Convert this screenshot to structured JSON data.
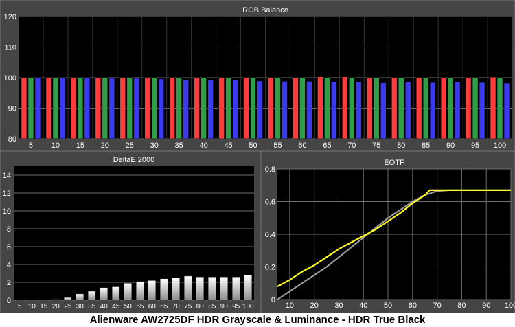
{
  "caption": "Alienware AW2725DF HDR Grayscale & Luminance - HDR True Black",
  "colors": {
    "panel_bg": "#454545",
    "plot_bg": "#000000",
    "grid": "#6e6e6e",
    "text": "#ffffff",
    "red": "#ff3b3b",
    "green": "#2f9e46",
    "blue": "#3a3af0",
    "eotf_target": "#9a9a9a",
    "eotf_measured": "#ffff22"
  },
  "chart_data": [
    {
      "id": "rgb",
      "type": "bar",
      "title": "RGB Balance",
      "xlabel": "",
      "ylabel": "",
      "ylim": [
        80,
        120
      ],
      "yticks": [
        80,
        90,
        100,
        110,
        120
      ],
      "categories": [
        "5",
        "10",
        "15",
        "20",
        "25",
        "30",
        "35",
        "40",
        "45",
        "50",
        "55",
        "60",
        "65",
        "70",
        "75",
        "80",
        "85",
        "90",
        "95",
        "100"
      ],
      "series": [
        {
          "color_key": "red",
          "values": [
            100,
            100,
            100,
            100,
            100,
            100,
            100,
            100,
            100,
            100,
            100,
            100,
            100.3,
            100.3,
            100,
            100,
            100,
            100,
            100,
            100.2
          ]
        },
        {
          "color_key": "green",
          "values": [
            100,
            100,
            100,
            100,
            100,
            100,
            100,
            100,
            100,
            100,
            100,
            100,
            100,
            100,
            100,
            100,
            100,
            100,
            100,
            100
          ]
        },
        {
          "color_key": "blue",
          "values": [
            100,
            100,
            100,
            99.8,
            99.8,
            99.6,
            99.4,
            99.2,
            99.2,
            98.9,
            98.8,
            98.8,
            98.6,
            98.5,
            98.3,
            98.5,
            98.4,
            98.5,
            98.4,
            98.2
          ]
        }
      ],
      "grid": true
    },
    {
      "id": "deltae",
      "type": "bar",
      "title": "DeltaE 2000",
      "xlabel": "",
      "ylabel": "",
      "ylim": [
        0,
        15
      ],
      "yticks": [
        0,
        2,
        4,
        6,
        8,
        10,
        12,
        14
      ],
      "categories": [
        "5",
        "10",
        "15",
        "20",
        "25",
        "30",
        "35",
        "40",
        "45",
        "50",
        "55",
        "60",
        "65",
        "70",
        "75",
        "80",
        "85",
        "90",
        "95",
        "100"
      ],
      "values": [
        0.05,
        0.05,
        0.05,
        0.1,
        0.3,
        0.7,
        1.0,
        1.4,
        1.5,
        1.9,
        2.1,
        2.2,
        2.4,
        2.5,
        2.7,
        2.6,
        2.6,
        2.6,
        2.6,
        2.8
      ],
      "grid": true
    },
    {
      "id": "eotf",
      "type": "line",
      "title": "EOTF",
      "xlabel": "",
      "ylabel": "",
      "xlim": [
        5,
        100
      ],
      "ylim": [
        0,
        0.8
      ],
      "xticks": [
        10,
        20,
        30,
        40,
        50,
        60,
        70,
        80,
        90,
        100
      ],
      "yticks": [
        0,
        0.2,
        0.4,
        0.6,
        0.8
      ],
      "series": [
        {
          "color_key": "eotf_target",
          "x": [
            5,
            10,
            15,
            20,
            25,
            30,
            35,
            40,
            45,
            50,
            55,
            60,
            65,
            70,
            75,
            80,
            85,
            90,
            95,
            100
          ],
          "y": [
            0.0,
            0.05,
            0.1,
            0.15,
            0.2,
            0.26,
            0.32,
            0.38,
            0.44,
            0.5,
            0.55,
            0.6,
            0.64,
            0.665,
            0.67,
            0.67,
            0.67,
            0.67,
            0.67,
            0.67
          ]
        },
        {
          "color_key": "eotf_measured",
          "x": [
            5,
            10,
            15,
            20,
            25,
            30,
            35,
            40,
            45,
            50,
            55,
            60,
            65,
            67,
            70,
            75,
            80,
            85,
            90,
            95,
            100
          ],
          "y": [
            0.08,
            0.12,
            0.17,
            0.21,
            0.26,
            0.31,
            0.35,
            0.39,
            0.43,
            0.48,
            0.53,
            0.59,
            0.64,
            0.67,
            0.67,
            0.67,
            0.67,
            0.67,
            0.67,
            0.67,
            0.67
          ]
        }
      ],
      "grid": true
    }
  ]
}
